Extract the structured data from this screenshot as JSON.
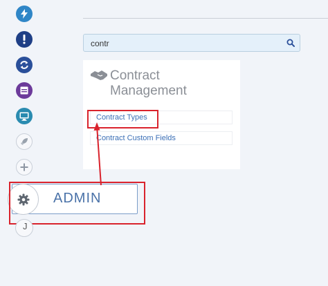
{
  "sidebar": {
    "items": [
      {
        "icon": "lightning-icon",
        "color": "#2f86c7"
      },
      {
        "icon": "exclamation-icon",
        "color": "#1f3f86"
      },
      {
        "icon": "sync-icon",
        "color": "#2a4f9a"
      },
      {
        "icon": "archive-icon",
        "color": "#6c3a9a"
      },
      {
        "icon": "monitor-icon",
        "color": "#2a8bb0"
      },
      {
        "icon": "rocket-icon",
        "color": "#c9cfd8"
      },
      {
        "icon": "plus-icon",
        "color": "#c9cfd8"
      }
    ]
  },
  "search": {
    "value": "contr",
    "icon": "search-icon"
  },
  "card": {
    "icon": "handshake-icon",
    "title": "Contract Management",
    "links": [
      "Contract Types",
      "Contract Custom Fields"
    ]
  },
  "admin": {
    "label": "ADMIN",
    "icon": "gear-icon"
  },
  "partial_button_glyph": "J",
  "colors": {
    "highlight": "#d9222c",
    "link": "#3b6fb6",
    "admin_text": "#4a72a8",
    "search_bg": "#e4f0fa"
  }
}
